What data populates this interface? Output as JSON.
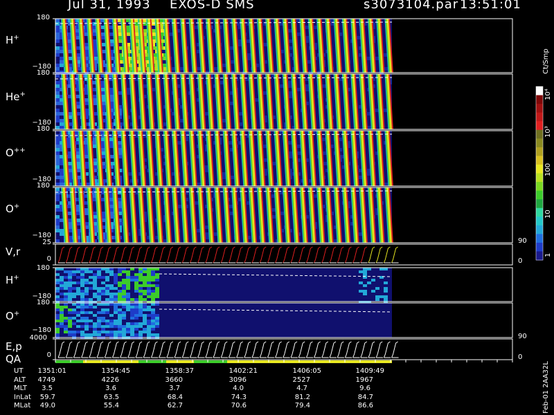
{
  "header": {
    "date": "Jul 31, 1993",
    "instrument": "EXOS-D SMS",
    "file": "s3073104.par",
    "time": "13:51:01"
  },
  "panels": [
    {
      "label": "H",
      "sup": "+",
      "ymax": "180",
      "ymin": "−180"
    },
    {
      "label": "He",
      "sup": "+",
      "ymax": "180",
      "ymin": "−180"
    },
    {
      "label": "O",
      "sup": "++",
      "ymax": "180",
      "ymin": "−180"
    },
    {
      "label": "O",
      "sup": "+",
      "ymax": "180",
      "ymin": "−180"
    },
    {
      "label": "V,r",
      "sup": "",
      "ymax": "25",
      "ymin": "0",
      "right_top": "90",
      "right_bottom": "0"
    },
    {
      "label": "H",
      "sup": "+",
      "ymax": "180",
      "ymin": "−180"
    },
    {
      "label": "O",
      "sup": "+",
      "ymax": "180",
      "ymin": "−180"
    },
    {
      "label": "E,p",
      "sup": "",
      "ymax": "4000",
      "ymin": "0",
      "right_top": "90",
      "right_bottom": "0"
    }
  ],
  "qa_label": "QA",
  "colorbar": {
    "unit": "Ct/Smp",
    "ticks": [
      "1",
      "10",
      "100",
      "10³",
      "10⁴"
    ],
    "colors": [
      "#1a1a8c",
      "#1e3cc8",
      "#1f6fe0",
      "#22a8d8",
      "#23c8c8",
      "#2fd8a0",
      "#1fa640",
      "#3ccc2a",
      "#7ad820",
      "#b8e020",
      "#e8e820",
      "#d8c020",
      "#b0a020",
      "#8a8a20",
      "#707020",
      "#e02020",
      "#c01818",
      "#a01010",
      "#800808",
      "#ffffff"
    ]
  },
  "orbit": {
    "labels": [
      "UT",
      "ALT",
      "MLT",
      "InLat",
      "MLat"
    ],
    "columns": [
      [
        "1351:01",
        "4749",
        "3.5",
        "59.7",
        "49.0"
      ],
      [
        "1354:45",
        "4226",
        "3.6",
        "63.5",
        "55.4"
      ],
      [
        "1358:37",
        "3660",
        "3.7",
        "68.4",
        "62.7"
      ],
      [
        "1402:21",
        "3096",
        "4.0",
        "74.3",
        "70.6"
      ],
      [
        "1406:05",
        "2527",
        "4.7",
        "81.2",
        "79.4"
      ],
      [
        "1409:49",
        "1967",
        "9.6",
        "84.7",
        "86.6"
      ]
    ]
  },
  "footer_id": "Feb-01 2AA32L",
  "chart_data": {
    "type": "heatmap",
    "title": "Jul 31, 1993 EXOS-D SMS",
    "x_ticks": [
      "1351:01",
      "1354:45",
      "1358:37",
      "1402:21",
      "1406:05",
      "1409:49"
    ],
    "panels": [
      {
        "name": "H+",
        "ylim": [
          -180,
          180
        ],
        "pattern": "spin-stripes, enhanced intensity 1353-1357"
      },
      {
        "name": "He+",
        "ylim": [
          -180,
          180
        ],
        "pattern": "spin-stripes, low background after 1354"
      },
      {
        "name": "O++",
        "ylim": [
          -180,
          180
        ],
        "pattern": "spin-stripes, low background after 1354"
      },
      {
        "name": "O+",
        "ylim": [
          -180,
          180
        ],
        "pattern": "spin-stripes, low background after 1354"
      },
      {
        "name": "V,r",
        "ylim": [
          0,
          25
        ],
        "y2lim": [
          0,
          90
        ],
        "pattern": "sawtooth traces"
      },
      {
        "name": "H+",
        "ylim": [
          -180,
          180
        ],
        "pattern": "patchy low counts 1351-1358"
      },
      {
        "name": "O+",
        "ylim": [
          -180,
          180
        ],
        "pattern": "patchy low counts 1351-1358"
      },
      {
        "name": "E,p",
        "ylim": [
          0,
          4000
        ],
        "y2lim": [
          0,
          90
        ],
        "pattern": "sawtooth traces"
      }
    ],
    "colorbar_range": [
      "1",
      "10⁴"
    ],
    "colorbar_unit": "Ct/Smp"
  }
}
